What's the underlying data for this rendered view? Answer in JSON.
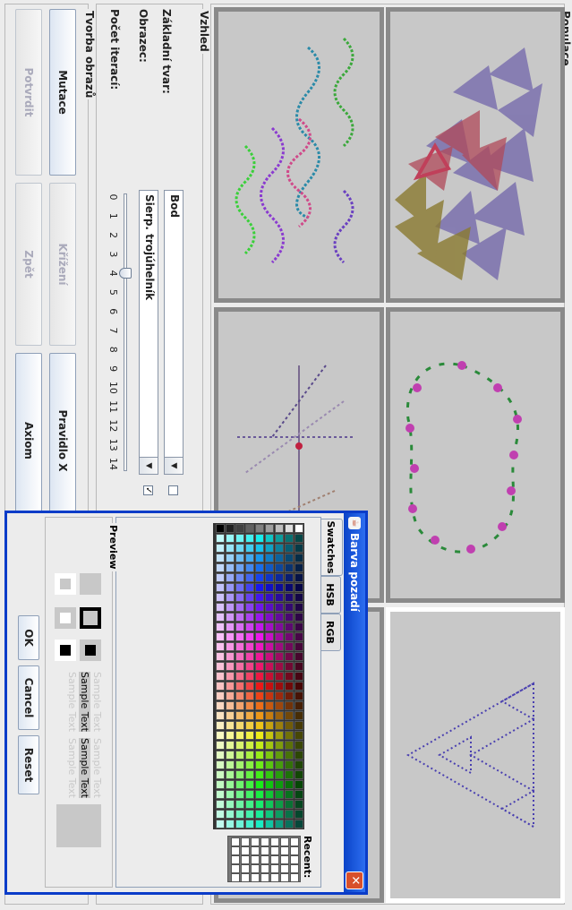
{
  "population": {
    "title": "Populace"
  },
  "appearance": {
    "title": "Vzhled",
    "base_shape_label": "Základní tvar:",
    "base_shape_value": "Bod",
    "pattern_label": "Obrazec:",
    "pattern_value": "Sierp. trojúhelník",
    "iterations_label": "Počet iterací:",
    "iteration_ticks": [
      "0",
      "1",
      "2",
      "3",
      "4",
      "5",
      "6",
      "7",
      "8",
      "9",
      "10",
      "11",
      "12",
      "13",
      "14"
    ],
    "iterations_value": 4
  },
  "creation": {
    "title": "Tvorba obrazů",
    "mutation_label": "Mutace",
    "crossover_label": "Křížení",
    "rule_x_label": "Pravidlo X",
    "confirm_label": "Potvrdit",
    "back_label": "Zpět",
    "axiom_label": "Axiom"
  },
  "dialog": {
    "title": "Barva pozadí",
    "tabs": [
      "Swatches",
      "HSB",
      "RGB"
    ],
    "active_tab": "Swatches",
    "recent_label": "Recent:",
    "preview_label": "Preview",
    "sample_text": "Sample Text",
    "ok_label": "OK",
    "cancel_label": "Cancel",
    "reset_label": "Reset",
    "close_icon": "close-icon",
    "title_icon": "java-cup-icon"
  },
  "colors": {
    "titlebar": "#0a43c8",
    "cell_border": "#8a8a8a",
    "cell_bg": "#c8c8c8",
    "selected_border": "#ffffff"
  }
}
